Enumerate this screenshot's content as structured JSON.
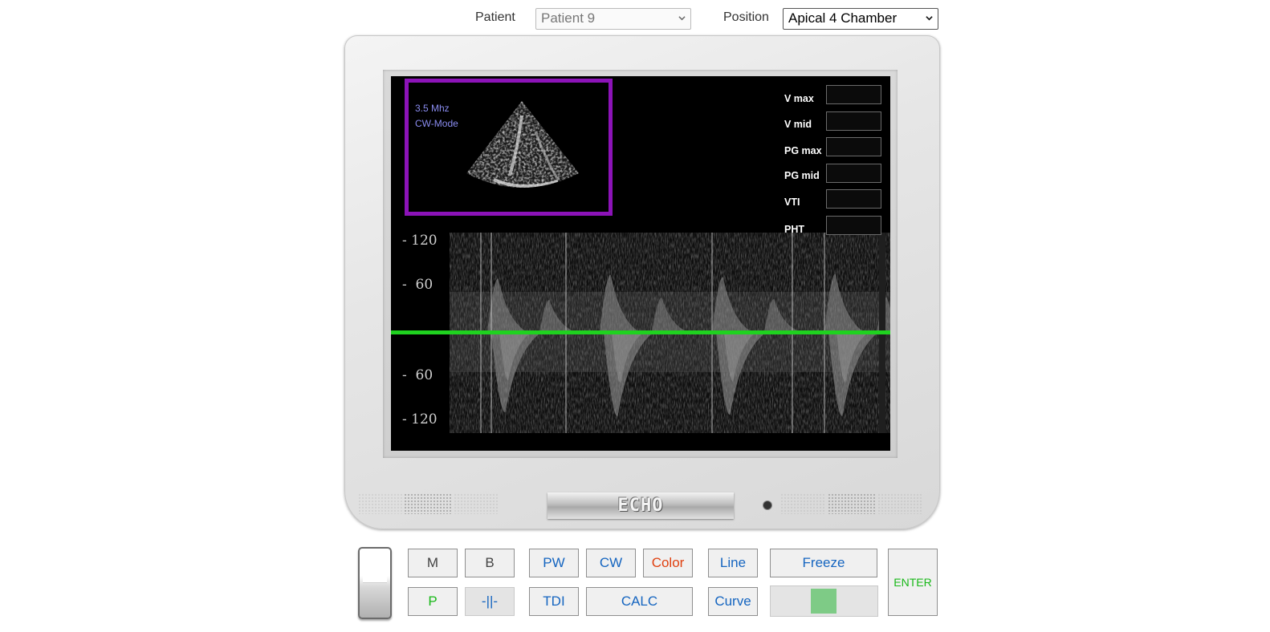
{
  "top_bar": {
    "patient_label": "Patient",
    "patient_value": "Patient 9",
    "position_label": "Position",
    "position_value": "Apical 4 Chamber"
  },
  "preview": {
    "frequency": "3.5 Mhz",
    "mode": "CW-Mode"
  },
  "measurements": [
    {
      "label": "V max",
      "value": ""
    },
    {
      "label": "V mid",
      "value": ""
    },
    {
      "label": "PG max",
      "value": ""
    },
    {
      "label": "PG mid",
      "value": ""
    },
    {
      "label": "VTI",
      "value": ""
    },
    {
      "label": "PHT",
      "value": ""
    }
  ],
  "doppler_axis": {
    "upper": [
      "- 120",
      "-  60"
    ],
    "lower": [
      "-  60",
      "- 120"
    ],
    "baseline_color": "#1fd21f"
  },
  "monitor": {
    "brand": "ECHO"
  },
  "controls": {
    "m": "M",
    "b": "B",
    "pw": "PW",
    "cw": "CW",
    "color": "Color",
    "line": "Line",
    "freeze": "Freeze",
    "enter": "ENTER",
    "p": "P",
    "split": "-||-",
    "tdi": "TDI",
    "calc": "CALC",
    "curve": "Curve",
    "gain_level": 0.5
  },
  "colors": {
    "accent_blue": "#1565c0",
    "accent_green": "#18b818",
    "accent_red": "#e0400f",
    "preview_border": "#8c13b8"
  }
}
